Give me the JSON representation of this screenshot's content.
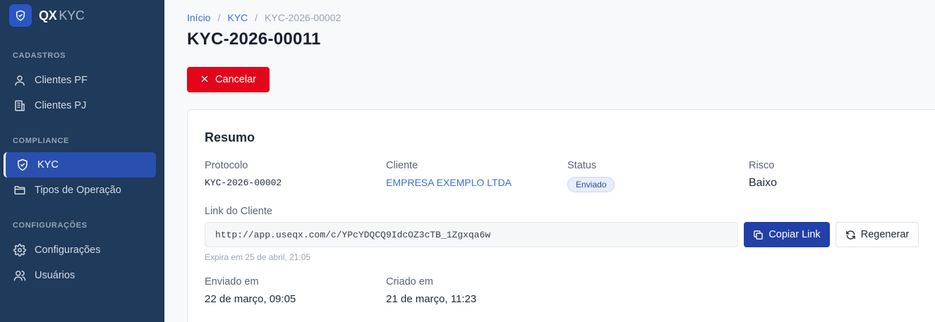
{
  "brand": {
    "name_bold": "QX",
    "name_light": "KYC"
  },
  "sidebar": {
    "sections": [
      {
        "label": "CADASTROS"
      },
      {
        "label": "COMPLIANCE"
      },
      {
        "label": "CONFIGURAÇÕES"
      }
    ],
    "items": [
      {
        "label": "Clientes PF",
        "icon": "user-icon"
      },
      {
        "label": "Clientes PJ",
        "icon": "building-icon"
      },
      {
        "label": "KYC",
        "icon": "shield-icon",
        "active": true
      },
      {
        "label": "Tipos de Operação",
        "icon": "folder-icon"
      },
      {
        "label": "Configurações",
        "icon": "gear-icon"
      },
      {
        "label": "Usuários",
        "icon": "users-icon"
      }
    ]
  },
  "breadcrumb": {
    "home": "Início",
    "kyc": "KYC",
    "current": "KYC-2026-00002",
    "separator": "/"
  },
  "page": {
    "title": "KYC-2026-00011"
  },
  "actions": {
    "cancel_label": "Cancelar"
  },
  "summary": {
    "title": "Resumo",
    "protocol_label": "Protocolo",
    "protocol_value": "KYC-2026-00002",
    "client_label": "Cliente",
    "client_value": "EMPRESA EXEMPLO LTDA",
    "status_label": "Status",
    "status_value": "Enviado",
    "risk_label": "Risco",
    "risk_value": "Baixo",
    "link_label": "Link do Cliente",
    "link_value": "http://app.useqx.com/c/YPcYDQCQ9IdcOZ3cTB_1Zgxqa6w",
    "copy_label": "Copiar Link",
    "regen_label": "Regenerar",
    "expires_text": "Expira em 25 de abril, 21:05",
    "sent_label": "Enviado em",
    "sent_value": "22 de março, 09:05",
    "created_label": "Criado em",
    "created_value": "21 de março, 11:23"
  },
  "colors": {
    "sidebar_bg": "#1f3a5a",
    "active_item": "#2a4fb0",
    "danger": "#e3061b",
    "primary": "#2340a8",
    "link": "#3b6fd6"
  }
}
